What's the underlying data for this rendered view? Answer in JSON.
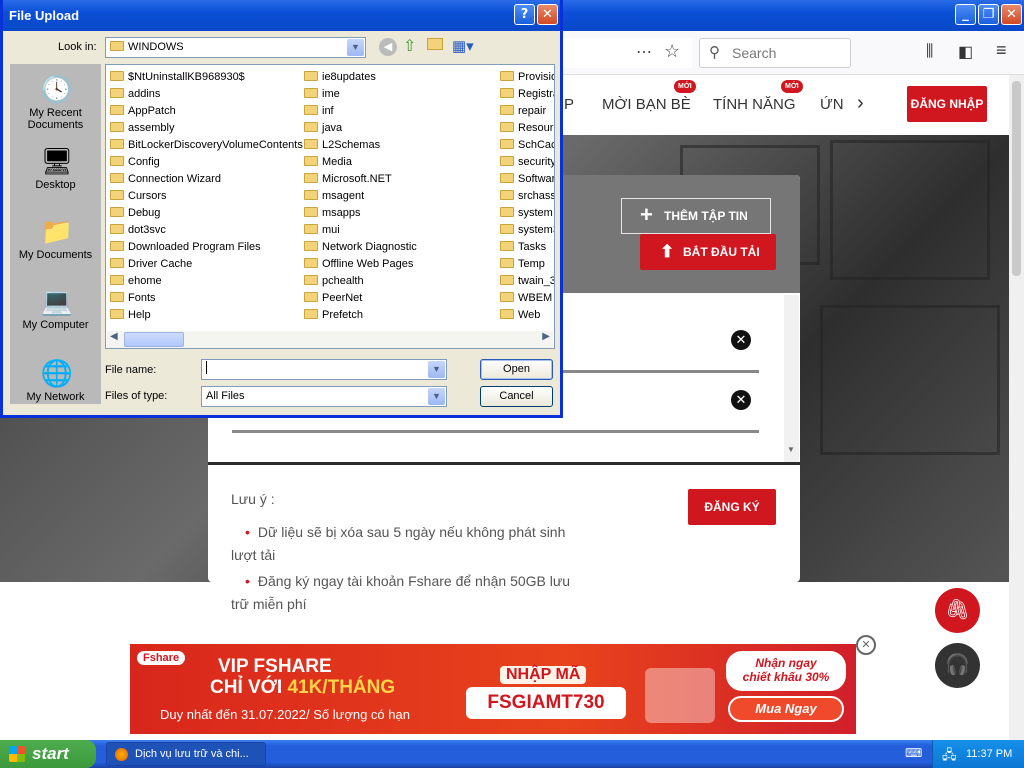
{
  "browser": {
    "search_placeholder": "Search",
    "win_min": "_",
    "win_max": "❐",
    "win_close": "✕"
  },
  "site": {
    "nav": [
      {
        "label": "P"
      },
      {
        "label": "MỜI BẠN BÈ",
        "badge": "MỚI"
      },
      {
        "label": "TÍNH NĂNG",
        "badge": "MỚI"
      },
      {
        "label": "ỨN"
      }
    ],
    "login": "ĐĂNG NHẬP",
    "add_file": "THÊM TẬP TIN",
    "start_upload": "BẮT ĐẦU TẢI",
    "note_title": "Lưu ý :",
    "notes": [
      "Dữ liệu sẽ bị xóa sau 5 ngày nếu không phát sinh lượt tải",
      "Đăng ký ngay tài khoản Fshare để nhận 50GB lưu trữ miễn phí"
    ],
    "register": "ĐĂNG KÝ",
    "remove_icon": "close-circle-icon"
  },
  "ad": {
    "brand": "Fshare",
    "line1": "VIP FSHARE",
    "line2a": "CHỈ VỚI ",
    "line2b": "41K/THÁNG",
    "deadline": "Duy nhất đến 31.07.2022/ Số lượng có hạn",
    "code_label": "NHẬP MÃ",
    "code": "FSGIAMT730",
    "promo1": "Nhận ngay",
    "promo2": "chiết khấu 30%",
    "cta": "Mua Ngay"
  },
  "dialog": {
    "title": "File Upload",
    "help": "?",
    "close": "✕",
    "look_in_label": "Look in:",
    "look_in_value": "WINDOWS",
    "places": [
      "My Recent Documents",
      "Desktop",
      "My Documents",
      "My Computer",
      "My Network"
    ],
    "files_col1": [
      "$NtUninstallKB968930$",
      "addins",
      "AppPatch",
      "assembly",
      "BitLockerDiscoveryVolumeContents",
      "Config",
      "Connection Wizard",
      "Cursors",
      "Debug",
      "dot3svc",
      "Downloaded Program Files",
      "Driver Cache",
      "ehome",
      "Fonts",
      "Help"
    ],
    "files_col2": [
      "ie8updates",
      "ime",
      "inf",
      "java",
      "L2Schemas",
      "Media",
      "Microsoft.NET",
      "msagent",
      "msapps",
      "mui",
      "Network Diagnostic",
      "Offline Web Pages",
      "pchealth",
      "PeerNet",
      "Prefetch"
    ],
    "files_col3": [
      "Provisio",
      "Registra",
      "repair",
      "Resourc",
      "SchCacl",
      "security",
      "Softwar",
      "srchass",
      "system",
      "system3",
      "Tasks",
      "Temp",
      "twain_3",
      "WBEM",
      "Web"
    ],
    "file_name_label": "File name:",
    "file_name_value": "",
    "file_type_label": "Files of type:",
    "file_type_value": "All Files",
    "open": "Open",
    "cancel": "Cancel"
  },
  "taskbar": {
    "start": "start",
    "task": "Dịch vụ lưu trữ và chi...",
    "clock": "11:37 PM"
  },
  "colors": {
    "brand_red": "#d0161f",
    "xp_blue": "#0a4fd6"
  }
}
